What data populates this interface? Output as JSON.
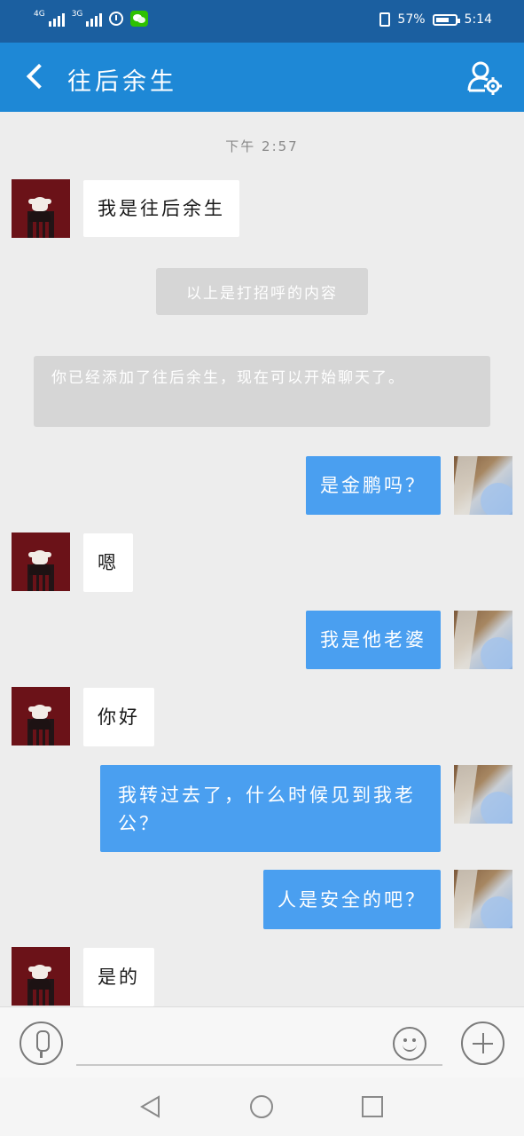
{
  "status_bar": {
    "network1": "4G",
    "network2": "3G",
    "battery_percent": "57%",
    "time": "5:14",
    "colors": {
      "background": "#1b5fa0"
    }
  },
  "header": {
    "back_icon": "chevron-left-icon",
    "title": "往后余生",
    "profile_icon": "user-settings-icon",
    "colors": {
      "background": "#1e88d6"
    }
  },
  "chat": {
    "timestamp": "下午 2:57",
    "messages": [
      {
        "from": "other",
        "text": "我是往后余生"
      },
      {
        "from": "system",
        "text": "以上是打招呼的内容"
      },
      {
        "from": "system",
        "text": "你已经添加了往后余生，现在可以开始聊天了。"
      },
      {
        "from": "self",
        "text": "是金鹏吗？"
      },
      {
        "from": "other",
        "text": "嗯"
      },
      {
        "from": "self",
        "text": "我是他老婆"
      },
      {
        "from": "other",
        "text": "你好"
      },
      {
        "from": "self",
        "text": "我转过去了，什么时候见到我老公？"
      },
      {
        "from": "self",
        "text": "人是安全的吧？"
      },
      {
        "from": "other",
        "text": "是的"
      }
    ],
    "colors": {
      "self_bubble": "#4a9ff0",
      "other_bubble": "#ffffff",
      "system_bubble": "#d6d6d6",
      "background": "#ededed"
    }
  },
  "input_bar": {
    "voice_icon": "microphone-icon",
    "placeholder": "",
    "emoji_icon": "emoji-icon",
    "plus_icon": "plus-icon"
  },
  "nav_bar": {
    "back_icon": "nav-back-icon",
    "home_icon": "nav-home-icon",
    "recent_icon": "nav-recent-icon"
  }
}
